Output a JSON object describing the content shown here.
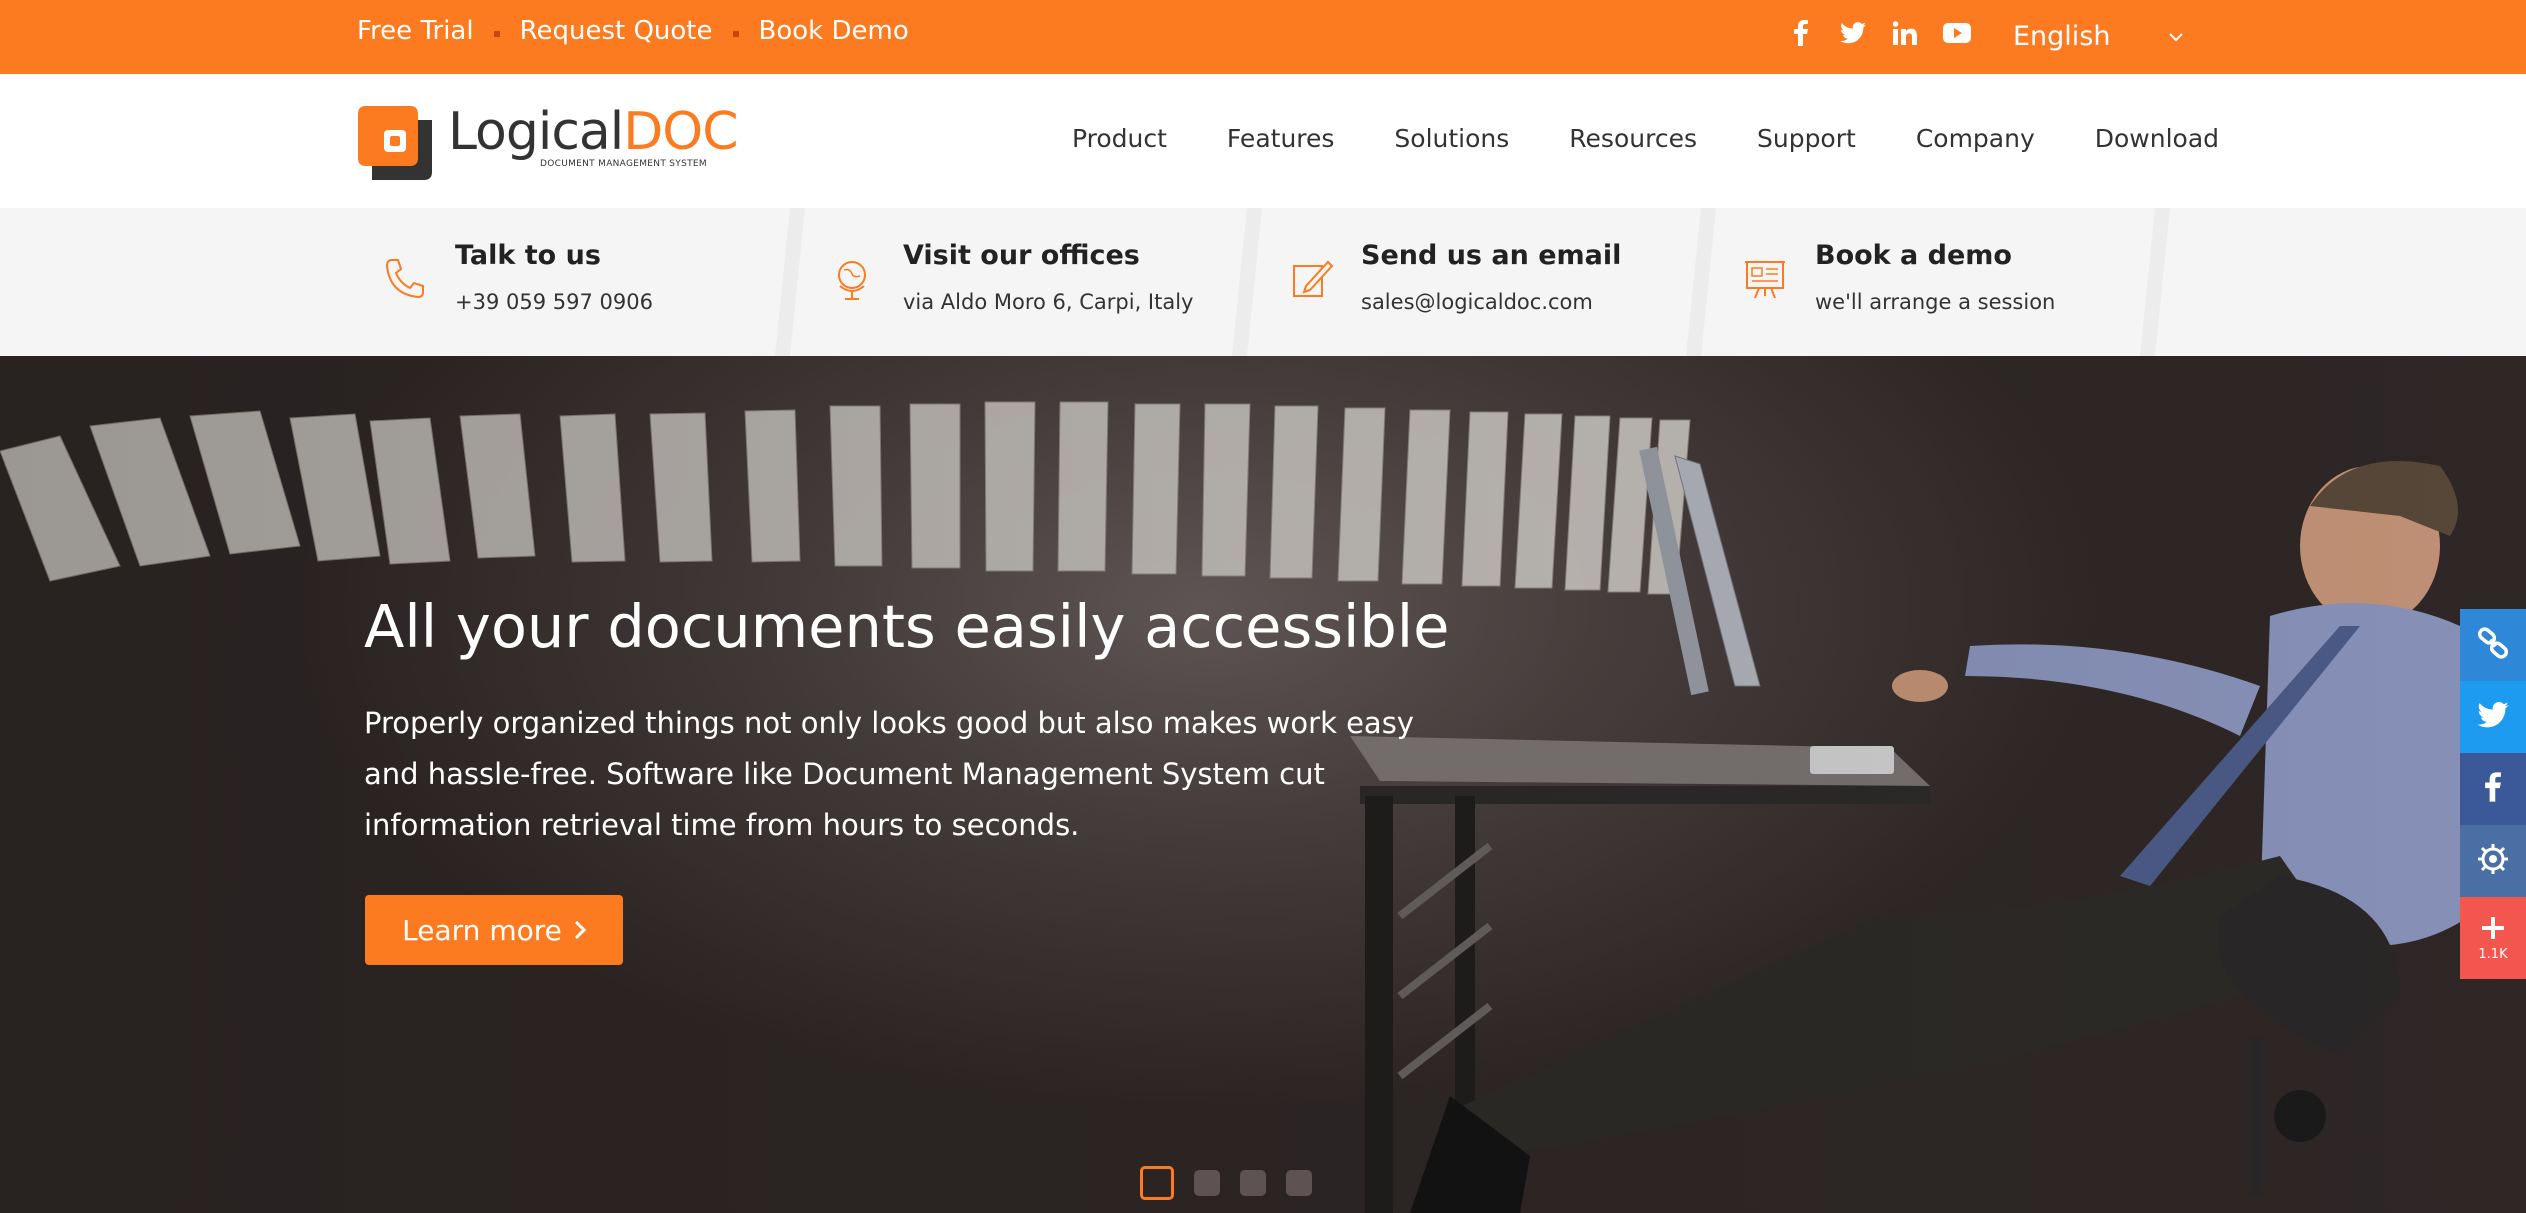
{
  "topbar": {
    "links": [
      "Free Trial",
      "Request Quote",
      "Book Demo"
    ],
    "social": [
      "facebook-icon",
      "twitter-icon",
      "linkedin-icon",
      "youtube-icon"
    ],
    "language": "English"
  },
  "header": {
    "logo": {
      "part1": "Logical",
      "part2": "DOC",
      "tagline": "DOCUMENT MANAGEMENT SYSTEM"
    },
    "nav": [
      "Product",
      "Features",
      "Solutions",
      "Resources",
      "Support",
      "Company",
      "Download"
    ]
  },
  "contact": [
    {
      "icon": "phone-icon",
      "title": "Talk to us",
      "subtitle": "+39 059 597 0906"
    },
    {
      "icon": "globe-icon",
      "title": "Visit our offices",
      "subtitle": "via Aldo Moro 6, Carpi, Italy"
    },
    {
      "icon": "pencil-icon",
      "title": "Send us an email",
      "subtitle": "sales@logicaldoc.com"
    },
    {
      "icon": "presentation-icon",
      "title": "Book a demo",
      "subtitle": "we'll arrange a session"
    }
  ],
  "hero": {
    "title": "All your documents easily accessible",
    "body": "Properly organized things not only looks good but also makes work easy and hassle-free. Software like Document Management System cut information retrieval time from hours to seconds.",
    "cta": "Learn more",
    "slides": 4,
    "active_slide": 1
  },
  "share": {
    "buttons": [
      "link-icon",
      "twitter-icon",
      "facebook-icon",
      "okru-icon",
      "plus-icon"
    ],
    "count": "1.1K"
  },
  "colors": {
    "accent": "#fd7b20",
    "accent_dark": "#c4470d",
    "text": "#333333"
  }
}
